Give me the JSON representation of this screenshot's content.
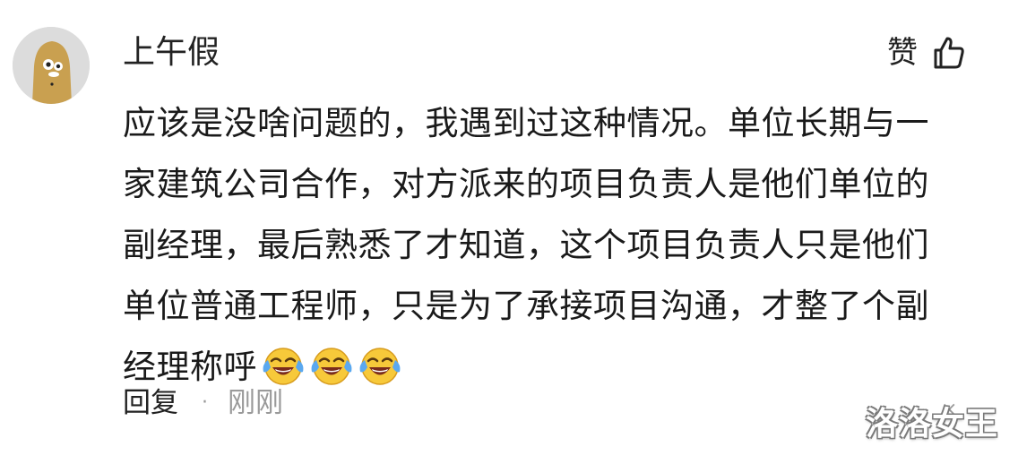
{
  "comment": {
    "username": "上午假",
    "avatar_icon": "chick-avatar-icon",
    "like_label": "赞",
    "like_icon": "thumbs-up-icon",
    "lines": [
      "应该是没啥问题的，我遇到过这种情况。单位长期与一",
      "家建筑公司合作，对方派来的项目负责人是他们单位的",
      "副经理，最后熟悉了才知道，这个项目负责人只是他们",
      "单位普通工程师，只是为了承接项目沟通，才整了个副",
      "经理称呼"
    ],
    "emojis": [
      "laugh-cry-emoji-icon",
      "laugh-cry-emoji-icon",
      "laugh-cry-emoji-icon"
    ],
    "reply_label": "回复",
    "separator": "·",
    "time": "刚刚",
    "dismiss_mark": "×"
  },
  "watermark": "洛洛女王",
  "colors": {
    "background": "#ffffff",
    "text": "#1a1a1a",
    "muted": "#9a9a9a",
    "avatar_bg": "#dcdcdc",
    "chick": "#c9a050",
    "emoji_face": "#f7c93a",
    "emoji_tears": "#5aa8ef"
  }
}
